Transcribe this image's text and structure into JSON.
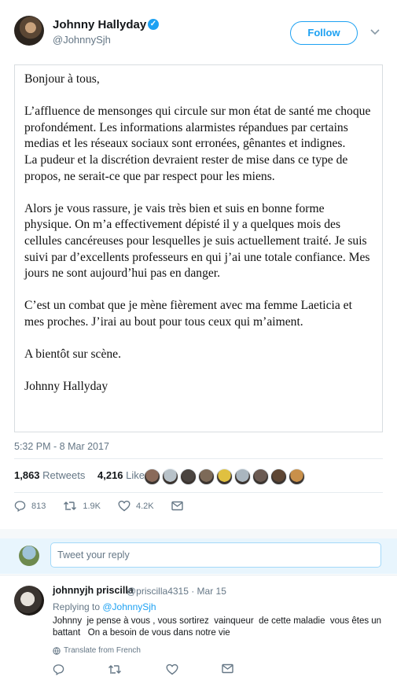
{
  "author": {
    "name": "Johnny Hallyday",
    "handle": "@JohnnySjh",
    "follow_label": "Follow",
    "verified_icon": "verified-badge-icon"
  },
  "letter": {
    "greeting": "Bonjour à tous,",
    "paragraph1": "L’affluence de mensonges qui circule sur mon état de santé me choque profondément. Les informations alarmistes répandues par certains medias et les réseaux sociaux sont erronées, gênantes et indignes.",
    "paragraph1b": "La pudeur et la discrétion devraient rester de mise dans ce type de propos, ne serait-ce que par respect pour les miens.",
    "paragraph2": "Alors je vous rassure, je vais très bien et suis en bonne forme physique. On m’a effectivement dépisté il y a quelques mois des cellules cancéreuses pour lesquelles je suis actuellement traité. Je suis suivi par d’excellents professeurs en qui j’ai une totale confiance. Mes jours ne sont aujourd’hui pas en danger.",
    "paragraph3": "C’est un combat que je mène fièrement avec ma femme Laeticia et mes proches. J’irai au bout pour tous ceux qui m’aiment.",
    "closing": "A bientôt sur scène.",
    "signature": "Johnny Hallyday"
  },
  "tweet": {
    "timestamp": "5:32 PM - 8 Mar 2017",
    "retweets_count": "1,863",
    "retweets_label": "Retweets",
    "likes_count": "4,216",
    "likes_label": "Likes",
    "reply_count": "813",
    "retweet_action_count": "1.9K",
    "like_action_count": "4.2K"
  },
  "likers": [
    {
      "color": "#8a6a5a"
    },
    {
      "color": "#b8c2c9"
    },
    {
      "color": "#4a4440"
    },
    {
      "color": "#7d6a58"
    },
    {
      "color": "#e0c040"
    },
    {
      "color": "#aab6bf"
    },
    {
      "color": "#6b5a52"
    },
    {
      "color": "#5e4634"
    },
    {
      "color": "#c9904a"
    }
  ],
  "reply_box": {
    "placeholder": "Tweet your reply"
  },
  "reply": {
    "name": "johnnyjh priscilla",
    "handle_date": "@priscilla4315 · Mar 15",
    "replying_prefix": "Replying to ",
    "replying_to": "@JohnnySjh",
    "text": "Johnny  je pense à vous , vous sortirez  vainqueur  de cette maladie  vous êtes un battant   On a besoin de vous dans notre vie",
    "translate_label": "Translate from French"
  },
  "colors": {
    "accent": "#1da1f2",
    "muted": "#657786"
  }
}
